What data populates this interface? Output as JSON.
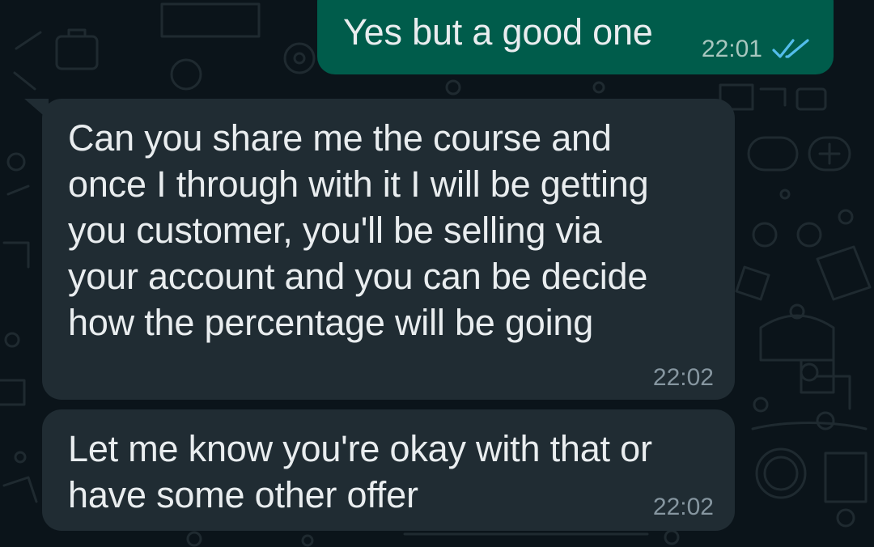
{
  "chat": {
    "messages": [
      {
        "direction": "outgoing",
        "text": "Yes but a good one",
        "time": "22:01",
        "status_icon": "double-check-read-icon",
        "read_color": "#53bdeb"
      },
      {
        "direction": "incoming",
        "text": "Can you share me the course and\nonce I  through with it I will be getting\nyou customer,  you'll  be selling  via\nyour account  and you can  be decide\nhow the percentage will be going",
        "time": "22:02"
      },
      {
        "direction": "incoming",
        "text": "Let me know you're okay with that or\nhave some other offer",
        "time": "22:02"
      }
    ]
  },
  "colors": {
    "background": "#0b141a",
    "outgoing_bubble": "#005c4b",
    "incoming_bubble": "#202c33",
    "text": "#e9edef",
    "meta": "#8696a0"
  }
}
